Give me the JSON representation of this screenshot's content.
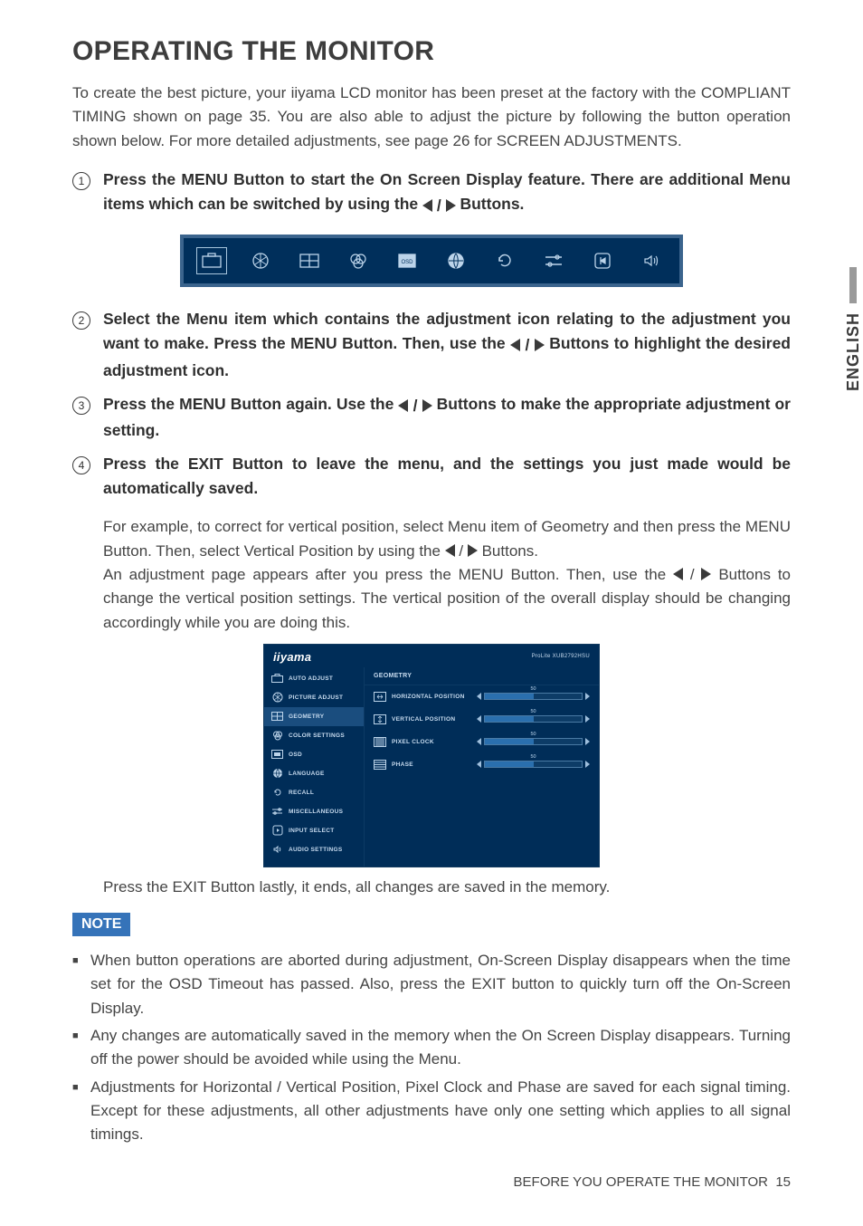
{
  "language_tab": "ENGLISH",
  "heading": "OPERATING THE MONITOR",
  "intro": "To create the best picture, your iiyama LCD monitor has been preset at the factory with the COMPLIANT TIMING shown on page 35. You are also able to adjust the picture by following the button operation shown below. For more detailed adjustments, see page 26 for SCREEN ADJUSTMENTS.",
  "steps": {
    "s1a": "Press the MENU Button to start the On Screen Display feature. There are additional Menu items which can be switched by using the ",
    "s1b": " Buttons.",
    "s2a": "Select the Menu item which contains the adjustment icon relating to the adjustment you want to make. Press the MENU Button. Then, use the ",
    "s2b": " Buttons to highlight the desired adjustment icon.",
    "s3a": "Press the MENU Button again. Use the ",
    "s3b": " Buttons to make the appropriate adjustment or setting.",
    "s4": "Press the EXIT Button to leave the menu, and the settings you just made would be automatically saved."
  },
  "example": {
    "e1a": "For example, to correct for vertical position, select Menu item of Geometry and then press the MENU Button. Then, select Vertical Position by using the ",
    "e1b": " Buttons.",
    "e2a": "An adjustment page appears after you press the MENU Button. Then, use the ",
    "e2b": " Buttons to change the vertical position settings. The vertical position of the overall display should be changing accordingly while you are doing this."
  },
  "osd": {
    "brand": "iiyama",
    "model": "ProLite XUB2792HSU",
    "left_items": [
      "AUTO ADJUST",
      "PICTURE ADJUST",
      "GEOMETRY",
      "COLOR SETTINGS",
      "OSD",
      "LANGUAGE",
      "RECALL",
      "MISCELLANEOUS",
      "INPUT SELECT",
      "AUDIO SETTINGS"
    ],
    "right_title": "GEOMETRY",
    "rows": [
      {
        "label": "HORIZONTAL POSITION",
        "value": "50",
        "fill": 50
      },
      {
        "label": "VERTICAL POSITION",
        "value": "50",
        "fill": 50
      },
      {
        "label": "PIXEL CLOCK",
        "value": "50",
        "fill": 50
      },
      {
        "label": "PHASE",
        "value": "50",
        "fill": 50
      }
    ]
  },
  "post_osd": "Press the EXIT Button lastly, it ends, all changes are saved in the memory.",
  "note_label": "NOTE",
  "notes": [
    "When button operations are aborted during adjustment, On-Screen Display disappears when the time set for the OSD Timeout has passed. Also, press the EXIT button to quickly turn off the On-Screen Display.",
    "Any changes are automatically saved in the memory when the On Screen Display disappears. Turning off the power should be avoided while using the Menu.",
    "Adjustments for Horizontal / Vertical Position, Pixel Clock and Phase are saved for each signal timing. Except for these adjustments, all other adjustments have only one setting which applies to all signal timings."
  ],
  "footer": {
    "label": "BEFORE YOU OPERATE THE MONITOR",
    "page": "15"
  }
}
